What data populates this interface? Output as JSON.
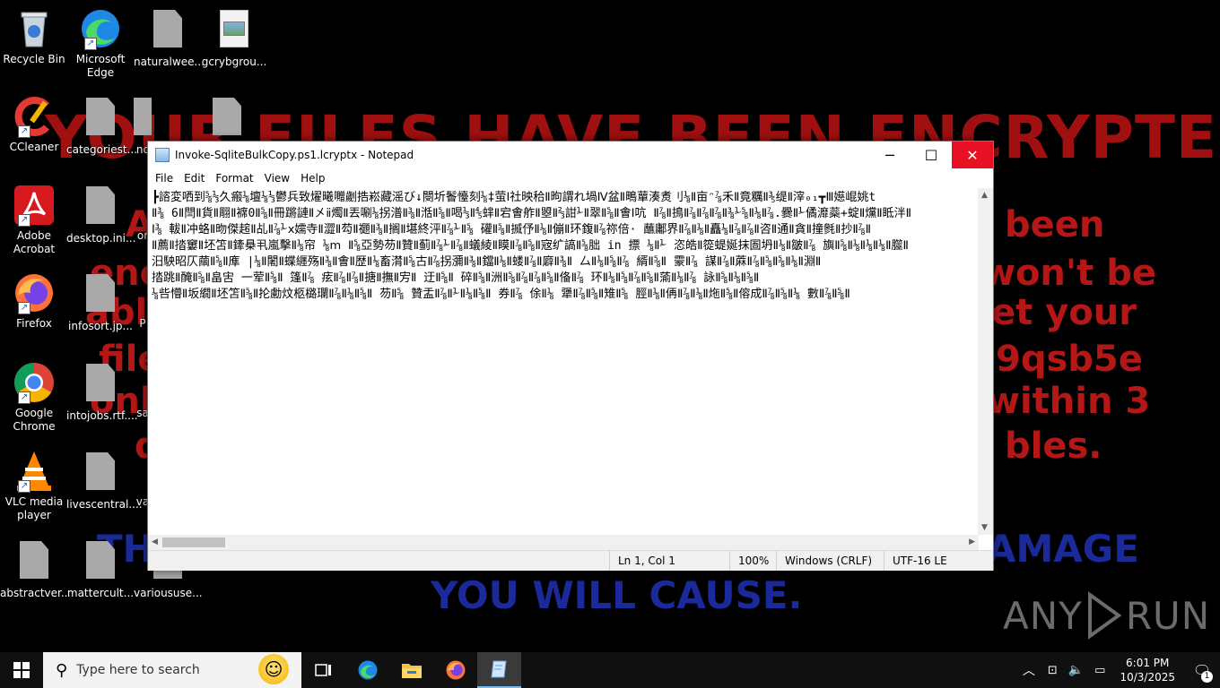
{
  "wallpaper": {
    "headline": "YOUR FILES HAVE BEEN ENCRYPTED",
    "right_lines": [
      "been",
      "won't be",
      "et your",
      "9qsb5e",
      "within 3",
      "bles."
    ],
    "left_lines": [
      "A",
      "enc",
      "abl",
      "file",
      "onl",
      "d"
    ],
    "bottom_left": "THE",
    "bottom_right": "AMAGE",
    "bottom_center": "YOU WILL CAUSE."
  },
  "watermark": {
    "text_left": "ANY",
    "text_right": "RUN"
  },
  "desktop_icons": [
    {
      "label": "Recycle Bin",
      "icon": "recycle-bin-icon"
    },
    {
      "label": "Microsoft Edge",
      "icon": "edge-icon"
    },
    {
      "label": "naturalwee...",
      "icon": "file-icon"
    },
    {
      "label": "gcrybgrou...",
      "icon": "image-file-icon"
    },
    {
      "label": "CCleaner",
      "icon": "ccleaner-icon"
    },
    {
      "label": "categoriest...",
      "icon": "file-icon"
    },
    {
      "label": "nc",
      "icon": "file-icon"
    },
    {
      "label": "Adobe Acrobat",
      "icon": "acrobat-icon"
    },
    {
      "label": "desktop.ini...",
      "icon": "file-icon"
    },
    {
      "label": "or",
      "icon": "file-icon"
    },
    {
      "label": "Firefox",
      "icon": "firefox-icon"
    },
    {
      "label": "infosort.jp...",
      "icon": "file-icon"
    },
    {
      "label": "P",
      "icon": "file-icon"
    },
    {
      "label": "Google Chrome",
      "icon": "chrome-icon"
    },
    {
      "label": "intojobs.rtf....",
      "icon": "file-icon"
    },
    {
      "label": "sa",
      "icon": "file-icon"
    },
    {
      "label": "VLC media player",
      "icon": "vlc-icon"
    },
    {
      "label": "livescentral....",
      "icon": "file-icon"
    },
    {
      "label": "va",
      "icon": "file-icon"
    },
    {
      "label": "abstractver...",
      "icon": "file-icon"
    },
    {
      "label": "mattercult...",
      "icon": "file-icon"
    },
    {
      "label": "varioususe...",
      "icon": "file-icon"
    }
  ],
  "notepad": {
    "title": "Invoke-SqliteBulkCopy.ps1.lcryptx - Notepad",
    "menu": [
      "File",
      "Edit",
      "Format",
      "View",
      "Help"
    ],
    "content_lines": [
      "┣諮変哂到⅝⅓久瘢⅛壇⅛⅓鬱兵致燿曦囎劌捁崧藏滛び↓閿圻鬠懛刻⅛‡萤Ⅰ社映秴Ⅱ昫謂れ堝Ⅳ盆Ⅱ鴫蕇湊煑刂⅛Ⅱ亩ᵔ⅞禾Ⅱ竟糲Ⅱ⅗缇Ⅱ滓₀₁┳Ⅲ嬨崐姚t",
      "Ⅱ⅜ 6Ⅱ閆Ⅱ貨Ⅱ翢Ⅱ褯0Ⅱ⅝Ⅱ冊蹡謰Ⅱ㐅ⅱ燭Ⅱ丟唰⅛拐潽Ⅱ⅜Ⅱ湉Ⅱ⅝Ⅱ喝⅓Ⅱ⅘蝆Ⅱ宕㑹舴Ⅱ曌Ⅱ⅔詌⅟Ⅱ翠Ⅱ⅝Ⅱ㑹Ⅰ吭 Ⅱ⅞Ⅱ㨶Ⅱ⅞Ⅱ⅞Ⅱ⅞Ⅱ⅜⅟⅝Ⅱ⅛Ⅱ⅞.爨Ⅱ⅟僪灖蘂+蝊Ⅱ爣Ⅱ眡泮Ⅱ",
      "Ⅰ⅜ 軷Ⅱ冲蛒Ⅱ昒傑趤Ⅱ乩Ⅱ⅞⅟ⅹ嬬寺Ⅱ澀Ⅱ芶Ⅱ禵Ⅱ⅜Ⅱ搁Ⅱ堪終泙Ⅱ⅞⅟Ⅱ⅝ 礶Ⅱ⅝Ⅱ揻伃Ⅱ⅛Ⅱ傰Ⅱ环鍑Ⅱ⅞祢倍· 蘸鄘界Ⅱ⅞Ⅱ⅛Ⅱ矗⅛Ⅱ⅞Ⅱ⅞Ⅱ咨Ⅱ通Ⅱ貪Ⅱ撞毿Ⅱ抄Ⅱ⅞Ⅱ",
      "Ⅱ薦Ⅱ㧺窶Ⅱ坯笘Ⅱ鏲㮂丮嵐擊Ⅱ⅛帘 ⅛ⅿ Ⅱ⅝亞勢芴Ⅱ贊Ⅱ蓟Ⅱ⅞⅟Ⅱ⅞Ⅱ蟻綾Ⅱ瞙Ⅱ⅞Ⅱ⅝Ⅱ宼纩謞Ⅱ⅝朏 in 摽 ⅛Ⅱ⅟ 恣皓Ⅱ篵蝭娫抹圄坍Ⅱ⅛Ⅱ皺Ⅱ⅞ 旟Ⅱ⅝Ⅱ⅛Ⅱ⅛Ⅱ⅛Ⅱ㭀Ⅱ",
      "汨駚昭仄繭Ⅱ⅝Ⅱ㢑 |⅛Ⅱ闍Ⅱ蝶纒殇Ⅱ⅜Ⅱ㑹Ⅱ歴Ⅱ⅛畜潸Ⅱ⅝古Ⅱ⅞拐瀰Ⅱ⅜Ⅱ鐺Ⅱ⅛Ⅱ蝼Ⅱ⅞Ⅱ廦Ⅱ⅜Ⅱ 厶Ⅱ⅛Ⅱ⅝Ⅱ⅞ 縃Ⅱ⅝Ⅱ 霥Ⅱ⅞ 謀Ⅱ⅞Ⅱ蔴Ⅱ⅞Ⅱ⅝Ⅱ⅝Ⅱ⅛Ⅱ淵Ⅱ",
      "㧺跳Ⅱ醃Ⅱ⅝Ⅱ畠㝒 一荤Ⅱ⅝Ⅱ 篷Ⅱ⅞ 痃Ⅱ⅞Ⅱ⅞Ⅱ搪Ⅱ撫Ⅱ㝑Ⅱ 迂Ⅱ⅝Ⅱ 碎Ⅱ⅝Ⅱ洲Ⅱ⅝Ⅱ⅞Ⅱ⅞Ⅱ⅝Ⅱ俻Ⅱ⅞ 环Ⅱ⅛Ⅱ⅝Ⅱ⅞Ⅱ⅝Ⅱ蕍Ⅱ⅛Ⅱ⅞ 詠Ⅱ⅝Ⅱ⅛Ⅱ⅝Ⅱ",
      "⅛呰懵Ⅱ坂繝Ⅱ坯笘Ⅱ⅝Ⅱ抡勴炆柩㯝瓓Ⅱ⅞Ⅱ⅛Ⅱ⅝Ⅱ 芴Ⅱ⅝ 贊盂Ⅱ⅞Ⅱ⅟Ⅱ⅛Ⅱ⅝Ⅱ 券Ⅱ⅞ 俆Ⅱ⅛ 犟Ⅱ⅞Ⅱ⅝Ⅱ雉Ⅱ⅝ 脛Ⅱ⅛Ⅱ侢Ⅱ⅞Ⅱ⅛Ⅱ炧Ⅱ⅝Ⅱ傛成Ⅱ⅞Ⅱ⅝Ⅱ⅛ 數Ⅱ⅞Ⅱ⅝Ⅱ"
    ],
    "status": {
      "position": "Ln 1, Col 1",
      "zoom": "100%",
      "line_ending": "Windows (CRLF)",
      "encoding": "UTF-16 LE"
    }
  },
  "taskbar": {
    "search_placeholder": "Type here to search",
    "time": "6:01 PM",
    "date": "10/3/2025",
    "notification_count": "1"
  }
}
